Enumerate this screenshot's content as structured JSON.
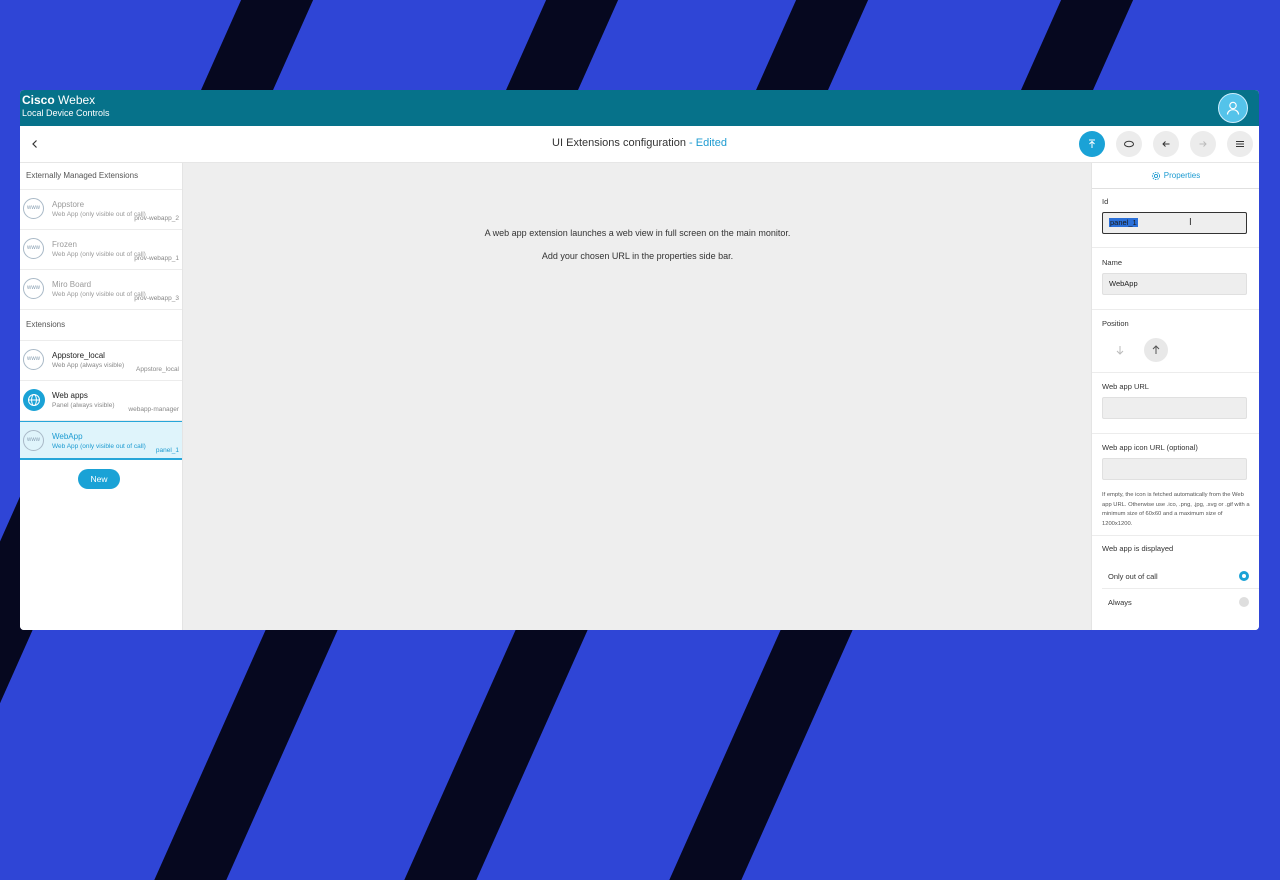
{
  "app": {
    "brand_bold": "Cisco",
    "brand_product": "Webex",
    "brand_sub": "Local Device Controls"
  },
  "toolbar": {
    "title": "UI Extensions configuration",
    "separator": " - ",
    "status": "Edited"
  },
  "sidebar": {
    "managed_header": "Externally Managed Extensions",
    "managed_items": [
      {
        "name": "Appstore",
        "desc": "Web App (only visible out of call)",
        "id": "prov-webapp_2"
      },
      {
        "name": "Frozen",
        "desc": "Web App (only visible out of call)",
        "id": "prov-webapp_1"
      },
      {
        "name": "Miro Board",
        "desc": "Web App (only visible out of call)",
        "id": "prov-webapp_3"
      }
    ],
    "extensions_header": "Extensions",
    "items": [
      {
        "name": "Appstore_local",
        "desc": "Web App (always visible)",
        "id": "Appstore_local"
      },
      {
        "name": "Web apps",
        "desc": "Panel (always visible)",
        "id": "webapp-manager"
      },
      {
        "name": "WebApp",
        "desc": "Web App (only visible out of call)",
        "id": "panel_1"
      }
    ],
    "www_label": "www",
    "new_button": "New"
  },
  "main": {
    "line1": "A web app extension launches a web view in full screen on the main monitor.",
    "line2": "Add your chosen URL in the properties side bar."
  },
  "properties": {
    "tab_label": "Properties",
    "id_label": "Id",
    "id_value": "panel_1",
    "name_label": "Name",
    "name_value": "WebApp",
    "position_label": "Position",
    "url_label": "Web app URL",
    "url_value": "",
    "icon_url_label": "Web app icon URL (optional)",
    "icon_url_value": "",
    "hint": "If empty, the icon is fetched automatically from the Web app URL. Otherwise use .ico, .png, .jpg, .svg or .gif with a minimum size of 60x60 and a maximum size of 1200x1200.",
    "displayed_label": "Web app is displayed",
    "options": [
      {
        "label": "Only out of call",
        "selected": true
      },
      {
        "label": "Always",
        "selected": false
      }
    ]
  },
  "colors": {
    "topbar": "#06728a",
    "accent": "#1aa2d6",
    "background": "#2f45d6",
    "stripes": "#06081f"
  }
}
